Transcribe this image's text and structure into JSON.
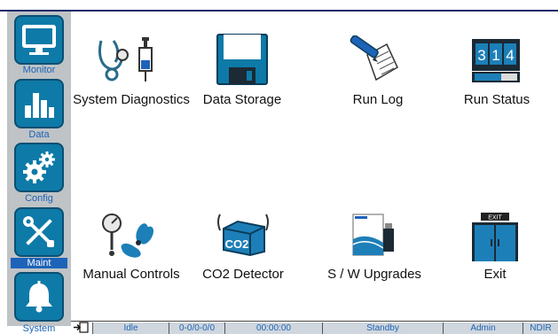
{
  "sidebar": {
    "items": [
      {
        "label": "Monitor",
        "icon": "monitor-icon",
        "active": false
      },
      {
        "label": "Data",
        "icon": "bar-chart-icon",
        "active": false
      },
      {
        "label": "Config",
        "icon": "gears-icon",
        "active": false
      },
      {
        "label": "Maint",
        "icon": "tools-icon",
        "active": true
      },
      {
        "label": "System",
        "icon": "bell-icon",
        "active": false
      }
    ]
  },
  "main": {
    "tiles": [
      {
        "label": "System Diagnostics",
        "icon": "stethoscope-syringe-icon"
      },
      {
        "label": "Data Storage",
        "icon": "floppy-disk-icon"
      },
      {
        "label": "Run Log",
        "icon": "pen-paper-icon"
      },
      {
        "label": "Run Status",
        "icon": "counter-display-icon"
      },
      {
        "label": "Manual Controls",
        "icon": "gauge-fan-icon"
      },
      {
        "label": "CO2 Detector",
        "icon": "co2-box-icon"
      },
      {
        "label": "S / W Upgrades",
        "icon": "usb-drive-icon"
      },
      {
        "label": "Exit",
        "icon": "exit-doors-icon"
      }
    ],
    "run_status_digits": "314",
    "co2_text": "CO2",
    "exit_sign": "EXIT"
  },
  "status_bar": {
    "state": "Idle",
    "counter": "0-0/0-0/0",
    "time": "00:00:00",
    "mode": "Standby",
    "user": "Admin",
    "detector": "NDIR"
  },
  "colors": {
    "tile_blue": "#0e7aa8",
    "label_blue": "#1d63b8",
    "sidebar_gray": "#bfc3c6",
    "status_fill": "#cfd6dd"
  }
}
